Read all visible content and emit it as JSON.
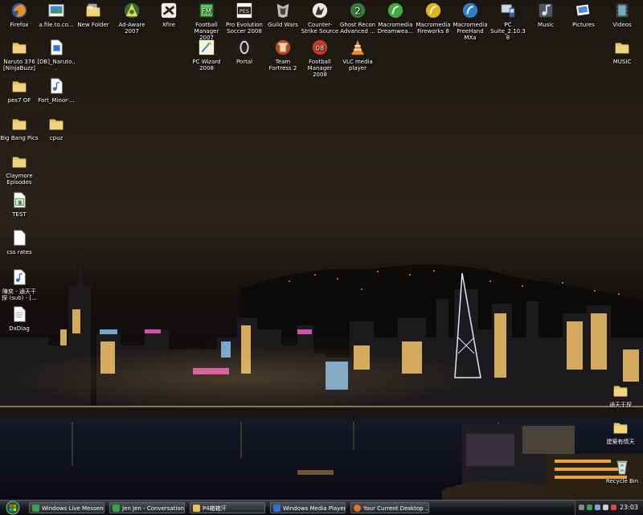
{
  "desktop_icons": [
    {
      "label": "Firefox",
      "icon": "firefox-icon"
    },
    {
      "label": "a.file.to.co...",
      "icon": "image-file-icon"
    },
    {
      "label": "New Folder",
      "icon": "folder-icon"
    },
    {
      "label": "Ad-Aware 2007",
      "icon": "ad-aware-icon"
    },
    {
      "label": "Xfire",
      "icon": "xfire-icon"
    },
    {
      "label": "Football Manager 2007",
      "icon": "football-manager-2007-icon"
    },
    {
      "label": "Pro Evolution Soccer 2008",
      "icon": "pes-2008-icon"
    },
    {
      "label": "Guild Wars",
      "icon": "guild-wars-icon"
    },
    {
      "label": "Counter-Strike Source",
      "icon": "counter-strike-icon"
    },
    {
      "label": "Ghost Recon Advanced ...",
      "icon": "ghost-recon-icon"
    },
    {
      "label": "Macromedia Dreamwea...",
      "icon": "dreamweaver-icon"
    },
    {
      "label": "Macromedia Fireworks 8",
      "icon": "fireworks-icon"
    },
    {
      "label": "Macromedia FreeHand MXa",
      "icon": "freehand-icon"
    },
    {
      "label": "PC Suite_2.10.38",
      "icon": "pc-suite-icon"
    },
    {
      "label": "Music",
      "icon": "music-folder-icon"
    },
    {
      "label": "Pictures",
      "icon": "pictures-folder-icon"
    },
    {
      "label": "Videos",
      "icon": "videos-folder-icon"
    },
    {
      "label": "Naruto 376 [NinjaBuzz]",
      "icon": "folder-icon"
    },
    {
      "label": "[DB]_Naruto...",
      "icon": "video-file-icon"
    },
    {
      "label": "PC Wizard 2008",
      "icon": "pc-wizard-icon"
    },
    {
      "label": "Portal",
      "icon": "portal-icon"
    },
    {
      "label": "Team Fortress 2",
      "icon": "team-fortress-icon"
    },
    {
      "label": "Football Manager 2008",
      "icon": "football-manager-2008-icon"
    },
    {
      "label": "VLC media player",
      "icon": "vlc-icon"
    },
    {
      "label": "MUSIC",
      "icon": "folder-icon"
    },
    {
      "label": "pes7 OF",
      "icon": "folder-icon"
    },
    {
      "label": "Fort_Minor-...",
      "icon": "audio-file-icon"
    },
    {
      "label": "Big Bang Pics",
      "icon": "folder-icon"
    },
    {
      "label": "cpuz",
      "icon": "folder-icon"
    },
    {
      "label": "Claymore Episodes",
      "icon": "folder-icon"
    },
    {
      "label": "TEST",
      "icon": "spreadsheet-icon"
    },
    {
      "label": "css rates",
      "icon": "document-icon"
    },
    {
      "label": "陳奕 - 通天干探 (sub) - [...",
      "icon": "audio-file-icon"
    },
    {
      "label": "DxDiag",
      "icon": "document-icon"
    },
    {
      "label": "通天干探",
      "icon": "folder-icon"
    },
    {
      "label": "建築有情天",
      "icon": "folder-icon"
    },
    {
      "label": "Recycle Bin",
      "icon": "recycle-bin-icon"
    }
  ],
  "taskbar": {
    "buttons": [
      {
        "label": "Windows Live Messenger",
        "color": "#3aa34a"
      },
      {
        "label": "Jen Jen - Conversation",
        "color": "#3aa34a"
      },
      {
        "label": "P4箱箱汗",
        "color": "#e8c44a"
      },
      {
        "label": "Windows Media Player",
        "color": "#3a6fd1"
      },
      {
        "label": "Your Current Desktop ...",
        "color": "#e0742a"
      }
    ],
    "clock": "23:03"
  }
}
